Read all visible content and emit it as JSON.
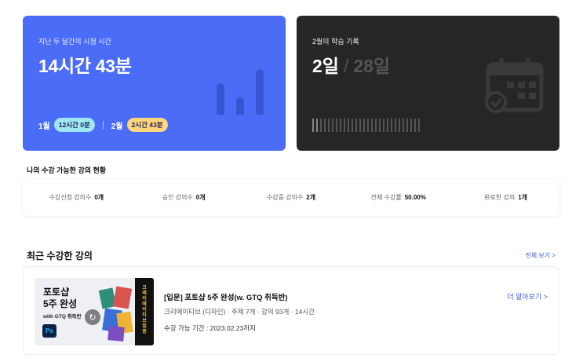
{
  "watch_card": {
    "label": "지난 두 달간의 시청 시간",
    "total": "14시간 43분",
    "jan_label": "1월",
    "jan_value": "12시간 0분",
    "feb_label": "2월",
    "feb_value": "2시간 43분",
    "colors": {
      "background": "#4a6cf7",
      "jan_pill": "#9fe7f2",
      "feb_pill": "#ffd57e"
    },
    "icon": "bar-chart-icon"
  },
  "study_card": {
    "label": "2월의 학습 기록",
    "days_done": "2일",
    "slash": "/",
    "days_total": "28일",
    "progress": {
      "done": 2,
      "total": 28
    },
    "colors": {
      "background": "#262626"
    },
    "icon": "calendar-check-icon"
  },
  "status_section": {
    "title": "나의 수강 가능한 강의 현황",
    "stats": [
      {
        "label": "수강신청 강의수",
        "value": "0개"
      },
      {
        "label": "승인 강의수",
        "value": "0개"
      },
      {
        "label": "수강중 강의수",
        "value": "2개"
      },
      {
        "label": "전체 수강률",
        "value": "50.00%"
      },
      {
        "label": "완료한 강의",
        "value": "1개"
      }
    ]
  },
  "recent": {
    "title": "최근 수강한 강의",
    "view_all": "전체 보기 >",
    "course": {
      "thumb_title_1": "포토샵",
      "thumb_title_2": "5주 완성",
      "thumb_sub": "with GTQ 취득반",
      "thumb_side": "크레이에이티브 집중",
      "ps_icon": "Ps",
      "name": "[입문] 포토샵 5주 완성(w. GTQ 취득반)",
      "meta": "크리에이티브 (디자인) · 주제 7개 · 강의 93개 · 14시간",
      "period": "수강 가능 기간 : 2023.02.23까지",
      "more": "더 알아보기 >"
    }
  }
}
